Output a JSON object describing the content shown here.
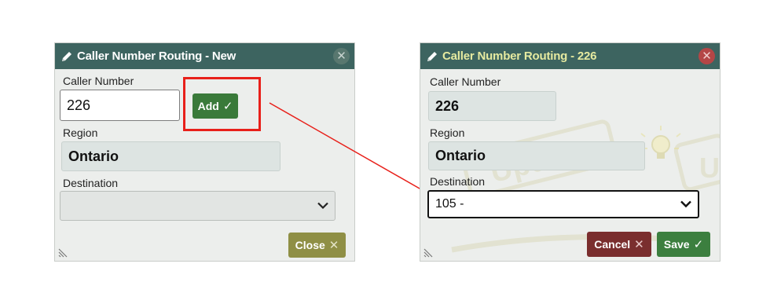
{
  "left_dialog": {
    "title": "Caller Number Routing - New",
    "caller_number_label": "Caller Number",
    "caller_number_value": "226",
    "add_button": "Add",
    "region_label": "Region",
    "region_value": "Ontario",
    "destination_label": "Destination",
    "destination_value": "",
    "close_button": "Close"
  },
  "right_dialog": {
    "title": "Caller Number Routing - 226",
    "caller_number_label": "Caller Number",
    "caller_number_value": "226",
    "region_label": "Region",
    "region_value": "Ontario",
    "destination_label": "Destination",
    "destination_value": "105 -",
    "cancel_button": "Cancel",
    "save_button": "Save",
    "watermark_text": "Update"
  },
  "colors": {
    "titlebar_bg": "#3d6460",
    "right_title_text": "#e6eaa0",
    "add_button": "#3a7a3a",
    "save_button": "#3c7f3f",
    "close_button": "#8f8f45",
    "cancel_button": "#7a2e2e",
    "annotation": "#e8201a"
  },
  "icons": {
    "pencil": "pencil-icon",
    "close": "close-icon",
    "check": "checkmark-icon",
    "cross": "cross-icon",
    "chevron": "chevron-down-icon",
    "resize": "resize-grip-icon",
    "lightbulb": "lightbulb-icon"
  }
}
